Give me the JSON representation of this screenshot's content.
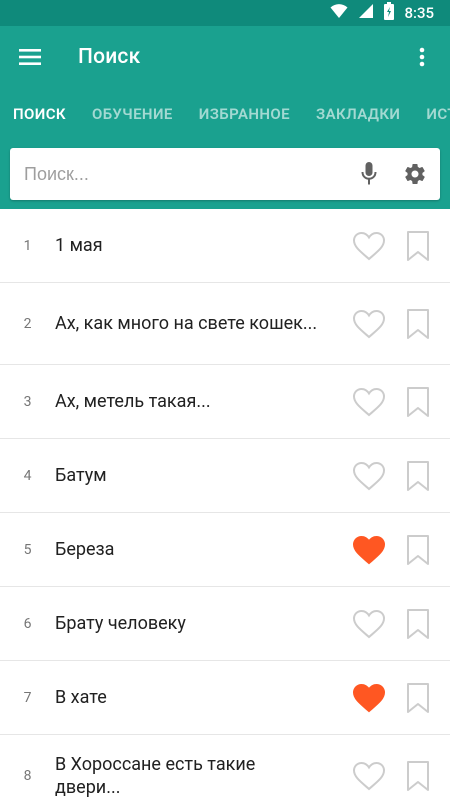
{
  "status": {
    "time": "8:35"
  },
  "app": {
    "title": "Поиск"
  },
  "tabs": [
    {
      "label": "ПОИСК",
      "active": true
    },
    {
      "label": "ОБУЧЕНИЕ",
      "active": false
    },
    {
      "label": "ИЗБРАННОЕ",
      "active": false
    },
    {
      "label": "ЗАКЛАДКИ",
      "active": false
    },
    {
      "label": "ИСТ",
      "active": false
    }
  ],
  "search": {
    "placeholder": "Поиск...",
    "value": ""
  },
  "colors": {
    "statusbar": "#0f8a7b",
    "primary": "#1aa18f",
    "favorite": "#ff5722",
    "icon_outline": "#cccccc"
  },
  "items": [
    {
      "num": "1",
      "title": "1 мая",
      "favorite": false
    },
    {
      "num": "2",
      "title": "Ах, как много на свете кошек...",
      "favorite": false
    },
    {
      "num": "3",
      "title": "Ах, метель такая...",
      "favorite": false
    },
    {
      "num": "4",
      "title": "Батум",
      "favorite": false
    },
    {
      "num": "5",
      "title": "Береза",
      "favorite": true
    },
    {
      "num": "6",
      "title": "Брату человеку",
      "favorite": false
    },
    {
      "num": "7",
      "title": "В хате",
      "favorite": true
    },
    {
      "num": "8",
      "title": "В Хороссане есть такие двери...",
      "favorite": false
    }
  ]
}
